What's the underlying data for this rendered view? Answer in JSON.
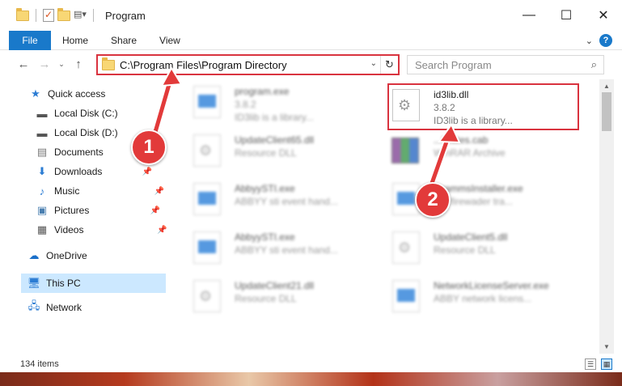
{
  "window": {
    "title": "Program",
    "minimize": "—",
    "maximize": "☐",
    "close": "✕"
  },
  "ribbon": {
    "tabs": [
      "File",
      "Home",
      "Share",
      "View"
    ],
    "expand": "⌄",
    "help": "?"
  },
  "nav": {
    "back": "←",
    "forward": "→",
    "recent": "⌄",
    "up": "↑"
  },
  "address": {
    "path": "C:\\Program Files\\Program Directory",
    "refresh": "↻",
    "dropdown": "⌄"
  },
  "search": {
    "placeholder": "Search Program"
  },
  "sidebar": {
    "items": [
      {
        "label": "Quick access",
        "icon": "star-icon"
      },
      {
        "label": "Local Disk (C:)",
        "icon": "drive-icon"
      },
      {
        "label": "Local Disk (D:)",
        "icon": "drive-icon"
      },
      {
        "label": "Documents",
        "icon": "documents-icon"
      },
      {
        "label": "Downloads",
        "icon": "download-icon"
      },
      {
        "label": "Music",
        "icon": "music-icon"
      },
      {
        "label": "Pictures",
        "icon": "pictures-icon"
      },
      {
        "label": "Videos",
        "icon": "videos-icon"
      },
      {
        "label": "OneDrive",
        "icon": "cloud-icon"
      },
      {
        "label": "This PC",
        "icon": "pc-icon"
      },
      {
        "label": "Network",
        "icon": "network-icon"
      }
    ]
  },
  "files": [
    {
      "name": "program.exe",
      "sub": "3.8.2",
      "sub2": "ID3lib is a library...",
      "icon": "exe-icon"
    },
    {
      "name": "id3lib.dll",
      "sub": "3.8.2",
      "sub2": "ID3lib is a library...",
      "icon": "dll-icon"
    },
    {
      "name": "UpdateClient65.dll",
      "sub": "Resource DLL",
      "icon": "dll-icon"
    },
    {
      "name": "...ficates.cab",
      "sub": "WinRAR Archive",
      "icon": "archive-icon"
    },
    {
      "name": "AbbyySTI.exe",
      "sub": "ABBYY sti event hand...",
      "icon": "exe-icon"
    },
    {
      "name": "...rammsInstaller.exe",
      "sub": "...Y firewader tra...",
      "icon": "exe-icon"
    },
    {
      "name": "AbbyySTI.exe",
      "sub": "ABBYY sti event hand...",
      "icon": "exe-icon"
    },
    {
      "name": "UpdateClient5.dll",
      "sub": "Resource DLL",
      "icon": "dll-icon"
    },
    {
      "name": "UpdateClient21.dll",
      "sub": "Resource DLL",
      "icon": "dll-icon"
    },
    {
      "name": "NetworkLicenseServer.exe",
      "sub": "ABBY network licens...",
      "icon": "exe-icon"
    }
  ],
  "callouts": [
    "1",
    "2"
  ],
  "status": {
    "item_count": "134 items"
  }
}
